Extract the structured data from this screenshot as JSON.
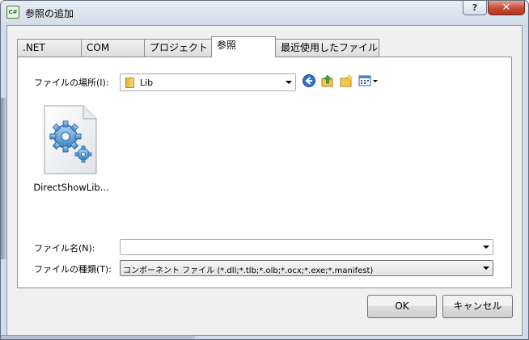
{
  "window": {
    "title": "参照の追加",
    "app_icon_text": "C#",
    "help_label": "?",
    "close_label": "✕"
  },
  "tabs": [
    {
      "label": ".NET",
      "active": false
    },
    {
      "label": "COM",
      "active": false
    },
    {
      "label": "プロジェクト",
      "active": false
    },
    {
      "label": "参照",
      "active": true
    },
    {
      "label": "最近使用したファイル",
      "active": false
    }
  ],
  "location": {
    "label": "ファイルの場所(I):",
    "value": "Lib"
  },
  "toolbar": {
    "icons": [
      "back-icon",
      "up-folder-icon",
      "new-folder-icon",
      "view-menu-icon"
    ]
  },
  "files": [
    {
      "name": "DirectShowLib...",
      "icon": "gear-document-icon"
    }
  ],
  "filename": {
    "label": "ファイル名(N):",
    "value": ""
  },
  "filetype": {
    "label": "ファイルの種類(T):",
    "value": "コンポーネント ファイル (*.dll;*.tlb;*.olb;*.ocx;*.exe;*.manifest)"
  },
  "buttons": {
    "ok": "OK",
    "cancel": "キャンセル"
  }
}
